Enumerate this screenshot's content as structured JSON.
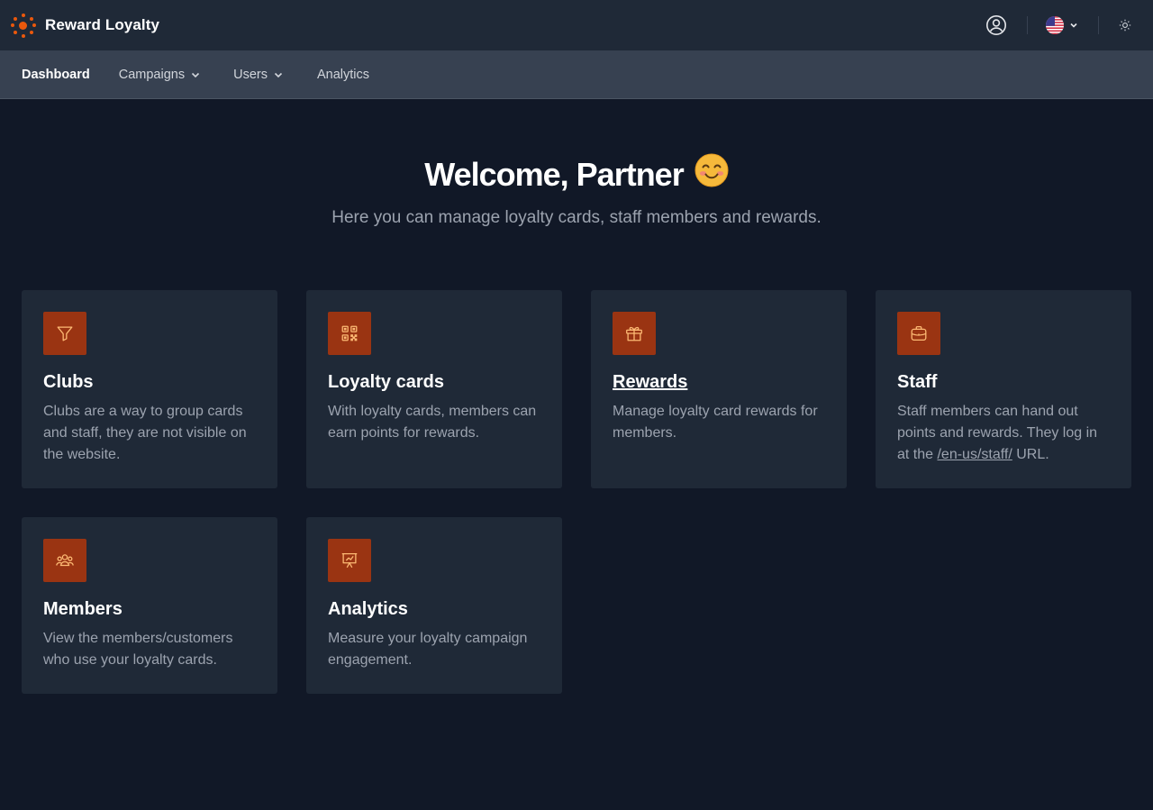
{
  "app": {
    "name": "Reward Loyalty",
    "brand_color": "#ea580c"
  },
  "header": {
    "account_icon": "user-circle-icon",
    "language": {
      "flag": "us-flag-icon",
      "chevron": "chevron-down-icon"
    },
    "theme_icon": "sun-icon"
  },
  "nav": {
    "items": [
      {
        "label": "Dashboard",
        "active": true
      },
      {
        "label": "Campaigns",
        "dropdown": true
      },
      {
        "label": "Users",
        "dropdown": true
      },
      {
        "label": "Analytics"
      }
    ]
  },
  "hero": {
    "title": "Welcome, Partner",
    "emoji": "😊",
    "subtitle": "Here you can manage loyalty cards, staff members and rewards."
  },
  "cards": [
    {
      "icon": "funnel-icon",
      "title": "Clubs",
      "description": "Clubs are a way to group cards and staff, they are not visible on the website."
    },
    {
      "icon": "qr-code-icon",
      "title": "Loyalty cards",
      "description": "With loyalty cards, members can earn points for rewards."
    },
    {
      "icon": "gift-icon",
      "title": "Rewards",
      "description": "Manage loyalty card rewards for members."
    },
    {
      "icon": "briefcase-icon",
      "title": "Staff",
      "description_before": "Staff members can hand out points and rewards. They log in at the ",
      "link": "/en-us/staff/",
      "description_after": " URL."
    },
    {
      "icon": "users-icon",
      "title": "Members",
      "description": "View the members/customers who use your loyalty cards."
    },
    {
      "icon": "presentation-chart-icon",
      "title": "Analytics",
      "description": "Measure your loyalty campaign engagement."
    }
  ],
  "colors": {
    "page_bg": "#111827",
    "card_bg": "#1f2937",
    "nav_bg": "#374151",
    "icon_tile": "#9a3412",
    "icon_stroke": "#fdba74"
  }
}
